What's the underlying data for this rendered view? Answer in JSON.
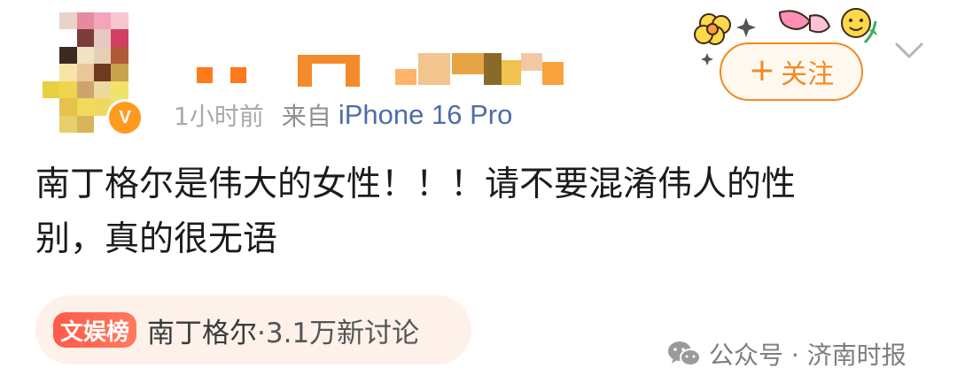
{
  "post": {
    "author": {
      "time": "1小时前",
      "source_prefix": "来自",
      "device": "iPhone 16 Pro",
      "verified_mark": "V"
    },
    "follow_button": {
      "plus": "+",
      "label": "关注"
    },
    "text_line1": "南丁格尔是伟大的女性！！！请不要混淆伟人的性",
    "text_line2": "别，真的很无语",
    "topic": {
      "badge": "文娱榜",
      "title": "南丁格尔",
      "stats": "·3.1万新讨论"
    }
  },
  "watermark": {
    "label": "公众号 · 济南时报"
  },
  "colors": {
    "accent_orange": "#f08a24",
    "link_blue": "#4f6ca8",
    "topic_red": "#ff5a48",
    "chip_bg": "#fdf1ea"
  },
  "icons": [
    "avatar-pixelated",
    "verified-icon",
    "flower-sticker-icon",
    "chevron-down-icon",
    "wechat-icon"
  ]
}
